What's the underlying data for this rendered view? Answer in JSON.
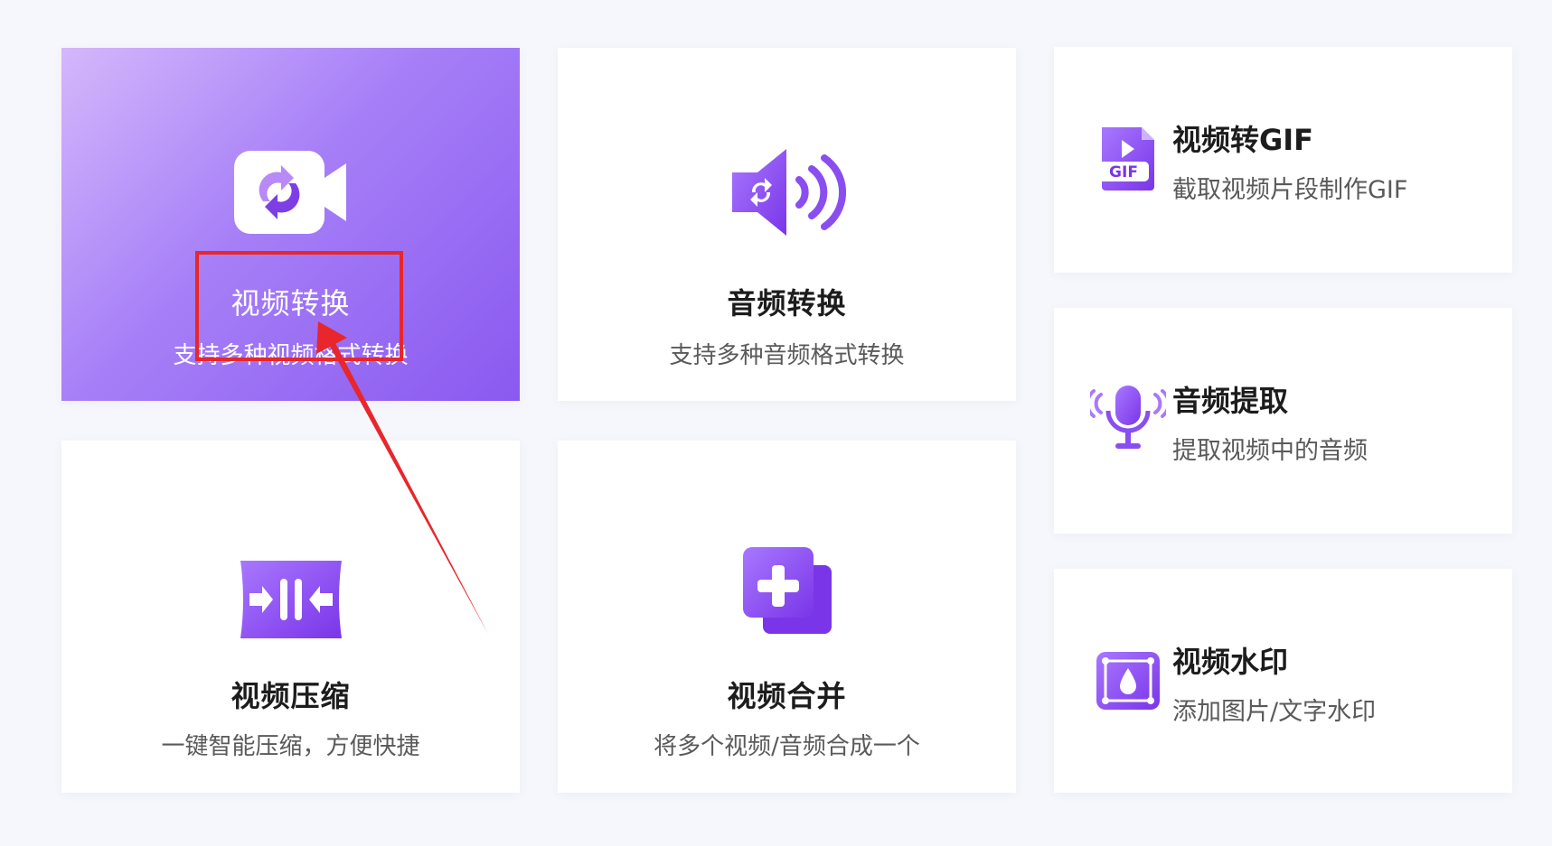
{
  "cards": [
    {
      "title": "视频转换",
      "desc": "支持多种视频格式转换"
    },
    {
      "title": "音频转换",
      "desc": "支持多种音频格式转换"
    },
    {
      "title": "视频转GIF",
      "desc": "截取视频片段制作GIF"
    },
    {
      "title": "音频提取",
      "desc": "提取视频中的音频"
    },
    {
      "title": "视频压缩",
      "desc": "一键智能压缩，方便快捷"
    },
    {
      "title": "视频合并",
      "desc": "将多个视频/音频合成一个"
    },
    {
      "title": "视频水印",
      "desc": "添加图片/文字水印"
    }
  ],
  "icons": {
    "gif_badge": "GIF"
  },
  "colors": {
    "accent": "#8a59f0",
    "accent_light": "#c79cff",
    "highlight": "#e8262b",
    "background": "#f6f7fc"
  }
}
